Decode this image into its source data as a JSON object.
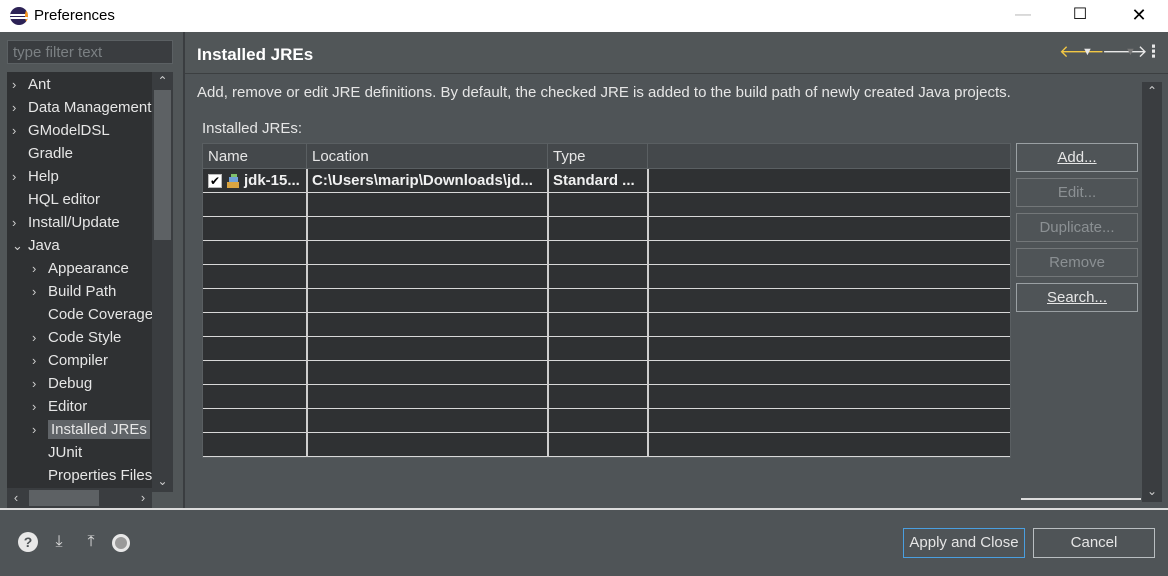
{
  "window": {
    "title": "Preferences"
  },
  "filter": {
    "placeholder": "type filter text"
  },
  "tree": [
    {
      "label": "Ant",
      "chevron": "›",
      "indent": 0
    },
    {
      "label": "Data Management",
      "chevron": "›",
      "indent": 0
    },
    {
      "label": "GModelDSL",
      "chevron": "›",
      "indent": 0
    },
    {
      "label": "Gradle",
      "chevron": "",
      "indent": 0
    },
    {
      "label": "Help",
      "chevron": "›",
      "indent": 0
    },
    {
      "label": "HQL editor",
      "chevron": "",
      "indent": 0
    },
    {
      "label": "Install/Update",
      "chevron": "›",
      "indent": 0
    },
    {
      "label": "Java",
      "chevron": "⌄",
      "indent": 0
    },
    {
      "label": "Appearance",
      "chevron": "›",
      "indent": 1
    },
    {
      "label": "Build Path",
      "chevron": "›",
      "indent": 1
    },
    {
      "label": "Code Coverage",
      "chevron": "",
      "indent": 1
    },
    {
      "label": "Code Style",
      "chevron": "›",
      "indent": 1
    },
    {
      "label": "Compiler",
      "chevron": "›",
      "indent": 1
    },
    {
      "label": "Debug",
      "chevron": "›",
      "indent": 1
    },
    {
      "label": "Editor",
      "chevron": "›",
      "indent": 1
    },
    {
      "label": "Installed JREs",
      "chevron": "›",
      "indent": 1,
      "selected": true
    },
    {
      "label": "JUnit",
      "chevron": "",
      "indent": 1
    },
    {
      "label": "Properties Files",
      "chevron": "",
      "indent": 1
    }
  ],
  "page": {
    "title": "Installed JREs",
    "description": "Add, remove or edit JRE definitions. By default, the checked JRE is added to the build path of newly created Java projects.",
    "jre_label": "Installed JREs:"
  },
  "table": {
    "columns": [
      "Name",
      "Location",
      "Type"
    ],
    "rows": [
      {
        "checked": true,
        "name": "jdk-15...",
        "location": "C:\\Users\\marip\\Downloads\\jd...",
        "type": "Standard ..."
      }
    ],
    "empty_rows": 11
  },
  "buttons": {
    "add": {
      "label": "Add...",
      "enabled": true
    },
    "edit": {
      "label": "Edit...",
      "enabled": false
    },
    "duplicate": {
      "label": "Duplicate...",
      "enabled": false
    },
    "remove": {
      "label": "Remove",
      "enabled": false
    },
    "search": {
      "label": "Search...",
      "enabled": true
    }
  },
  "footer": {
    "apply_close": "Apply and Close",
    "cancel": "Cancel"
  },
  "colors": {
    "accent_back_arrow": "#f2c744",
    "focus_border": "#4a9fe0",
    "table_bg": "#2f3133"
  }
}
